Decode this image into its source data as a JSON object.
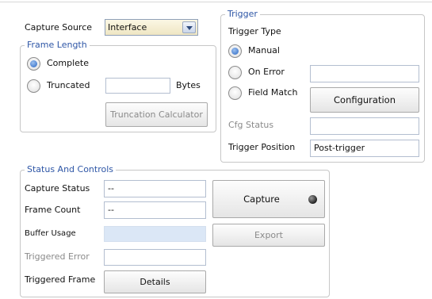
{
  "capture_source": {
    "label": "Capture Source",
    "value": "Interface"
  },
  "frame_length": {
    "legend": "Frame Length",
    "complete_label": "Complete",
    "truncated_label": "Truncated",
    "truncated_value": "",
    "bytes_label": "Bytes",
    "truncation_calculator_label": "Truncation Calculator",
    "selected": "complete"
  },
  "trigger": {
    "legend": "Trigger",
    "type_label": "Trigger Type",
    "manual_label": "Manual",
    "on_error_label": "On Error",
    "on_error_value": "",
    "field_match_label": "Field Match",
    "configuration_label": "Configuration",
    "cfg_status_label": "Cfg Status",
    "cfg_status_value": "",
    "position_label": "Trigger Position",
    "position_value": "Post-trigger",
    "selected": "manual"
  },
  "status": {
    "legend": "Status And Controls",
    "capture_status_label": "Capture Status",
    "capture_status_value": "--",
    "frame_count_label": "Frame Count",
    "frame_count_value": "--",
    "buffer_usage_label": "Buffer Usage",
    "buffer_usage_value": "",
    "triggered_error_label": "Triggered Error",
    "triggered_error_value": "",
    "triggered_frame_label": "Triggered Frame",
    "details_label": "Details",
    "capture_button_label": "Capture",
    "export_button_label": "Export"
  }
}
